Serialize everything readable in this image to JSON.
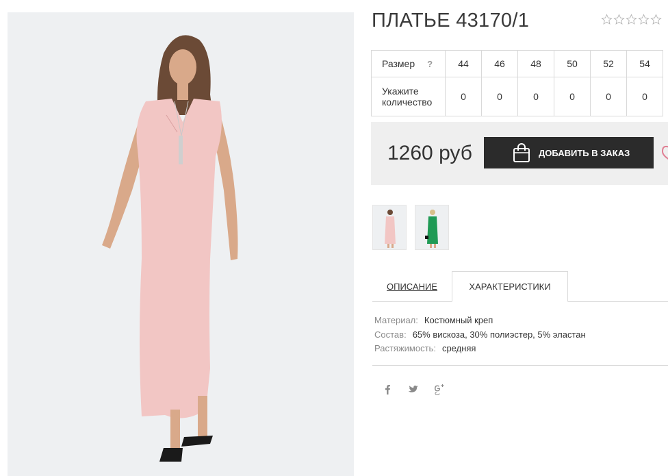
{
  "product": {
    "title": "ПЛАТЬЕ 43170/1",
    "rating": {
      "value": 0,
      "max": 5
    }
  },
  "size_table": {
    "size_label": "Размер",
    "help": "?",
    "qty_label": "Укажите количество",
    "sizes": [
      "44",
      "46",
      "48",
      "50",
      "52",
      "54"
    ],
    "quantities": [
      "0",
      "0",
      "0",
      "0",
      "0",
      "0"
    ]
  },
  "purchase": {
    "price": "1260 руб",
    "add_label": "ДОБАВИТЬ В ЗАКАЗ"
  },
  "thumbnails": [
    {
      "color": "#f2c6c4"
    },
    {
      "color": "#1f9a55"
    }
  ],
  "tabs": {
    "description": "ОПИСАНИЕ",
    "characteristics": "ХАРАКТЕРИСТИКИ"
  },
  "specs": [
    {
      "key": "Материал:",
      "value": "Костюмный креп"
    },
    {
      "key": "Состав:",
      "value": "65% вискоза, 30% полиэстер, 5% эластан"
    },
    {
      "key": "Растяжимость:",
      "value": "средняя"
    }
  ],
  "social": [
    "facebook-icon",
    "twitter-icon",
    "google-plus-icon"
  ],
  "colors": {
    "accent": "#2b2b2b",
    "price_bg": "#efefef",
    "dress": "#f2c6c4"
  }
}
